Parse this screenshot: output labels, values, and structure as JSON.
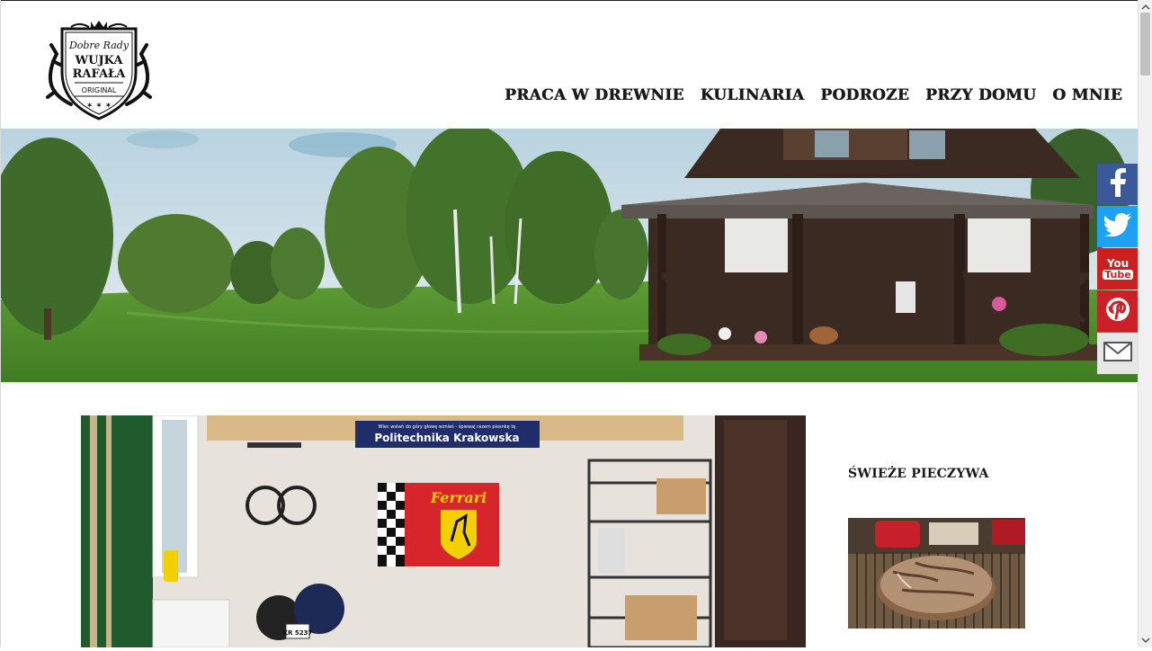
{
  "header": {
    "logo": {
      "line1": "Dobre Rady",
      "line2": "WUJKA",
      "line3": "RAFAŁA",
      "line4": "ORIGINAL"
    },
    "nav": [
      {
        "label": "PRACA W DREWNIE"
      },
      {
        "label": "KULINARIA"
      },
      {
        "label": "PODROZE"
      },
      {
        "label": "PRZY DOMU"
      },
      {
        "label": "O MNIE"
      }
    ]
  },
  "hero": {
    "icon": "garden-house-panorama"
  },
  "social": [
    {
      "name": "facebook",
      "glyph": "f",
      "color": "#3b5998"
    },
    {
      "name": "twitter",
      "glyph": "bird",
      "color": "#1da1f2"
    },
    {
      "name": "youtube",
      "glyph_top": "You",
      "glyph_bottom": "Tube",
      "color": "#cc1f1f"
    },
    {
      "name": "pinterest",
      "glyph": "P",
      "color": "#cb2027"
    },
    {
      "name": "email",
      "glyph": "envelope",
      "color": "#e6e6e6"
    }
  ],
  "main": {
    "garage_banner": "Politechnika Krakowska",
    "garage_banner_top": "Wiec wstań do góry głowę wznieś - śpiewaj razem piosnkę tę",
    "flag_text": "Ferrari",
    "plate": "KR 5237"
  },
  "sidebar": {
    "title": "ŚWIEŻE PIECZYWA"
  }
}
